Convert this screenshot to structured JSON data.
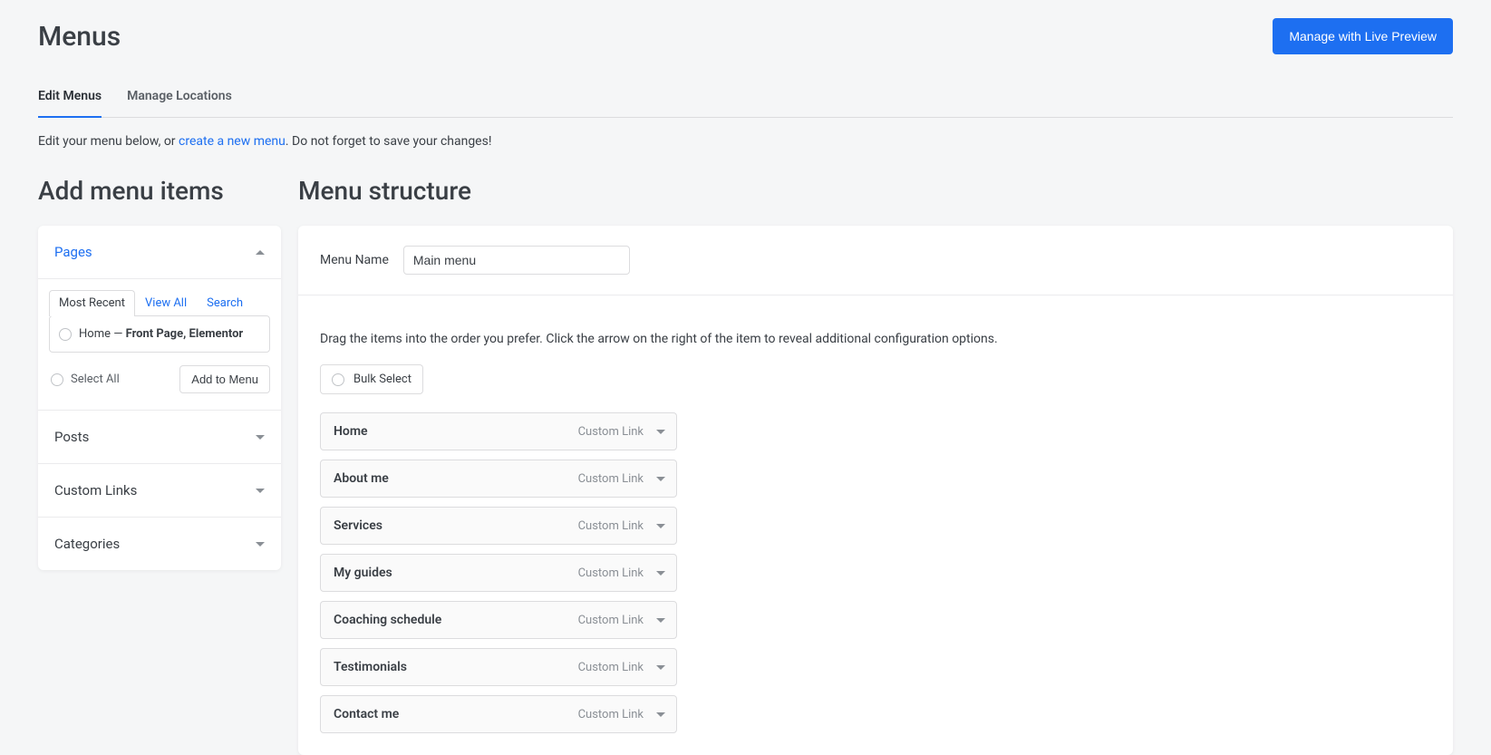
{
  "header": {
    "title": "Menus",
    "live_preview_button": "Manage with Live Preview"
  },
  "tabs": {
    "edit_menus": "Edit Menus",
    "manage_locations": "Manage Locations"
  },
  "hint": {
    "prefix": "Edit your menu below, or ",
    "link": "create a new menu",
    "suffix": ". Do not forget to save your changes!"
  },
  "left": {
    "title": "Add menu items",
    "pages": {
      "label": "Pages",
      "inner_tabs": {
        "most_recent": "Most Recent",
        "view_all": "View All",
        "search": "Search"
      },
      "item_prefix": "Home — ",
      "item_suffix": "Front Page, Elementor",
      "select_all": "Select All",
      "add_to_menu": "Add to Menu"
    },
    "posts": "Posts",
    "custom_links": "Custom Links",
    "categories": "Categories"
  },
  "right": {
    "title": "Menu structure",
    "menu_name_label": "Menu Name",
    "menu_name_value": "Main menu",
    "structure_hint": "Drag the items into the order you prefer. Click the arrow on the right of the item to reveal additional configuration options.",
    "bulk_select": "Bulk Select",
    "type_label": "Custom Link",
    "items": [
      {
        "label": "Home"
      },
      {
        "label": "About me"
      },
      {
        "label": "Services"
      },
      {
        "label": "My guides"
      },
      {
        "label": "Coaching schedule"
      },
      {
        "label": "Testimonials"
      },
      {
        "label": "Contact me"
      }
    ]
  }
}
